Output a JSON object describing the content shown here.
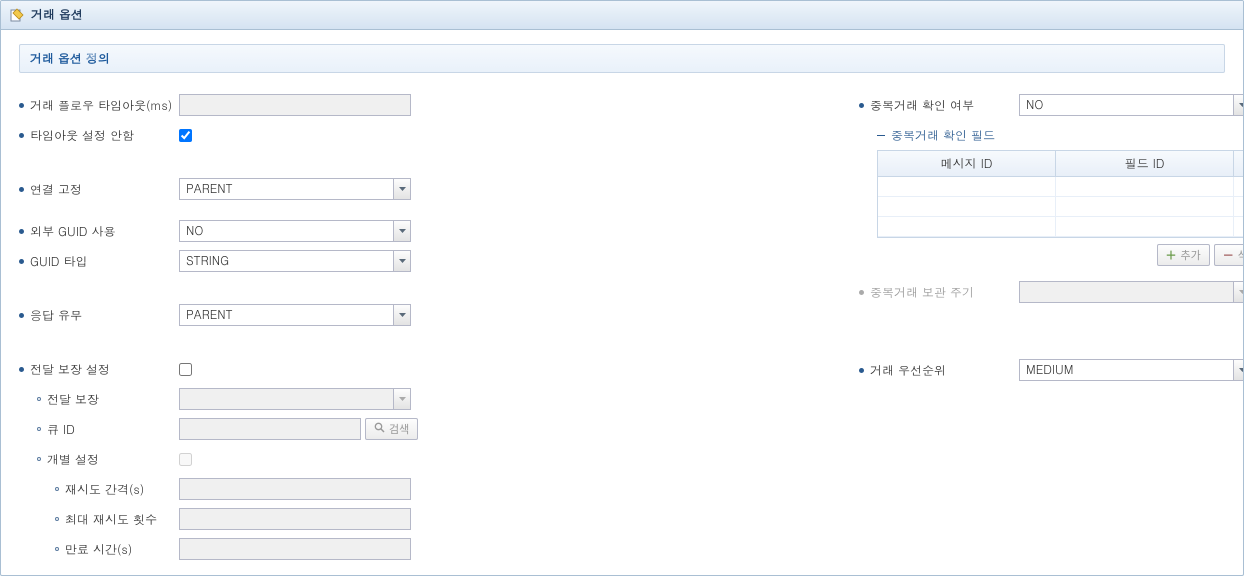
{
  "header": {
    "title": "거래 옵션"
  },
  "sub_header": {
    "title": "거래 옵션 정의"
  },
  "left": {
    "flow_timeout_label": "거래 플로우 타임아웃(ms)",
    "flow_timeout_value": "",
    "no_timeout_label": "타임아웃 설정 안함",
    "no_timeout_checked": true,
    "conn_fix_label": "연결 고정",
    "conn_fix_value": "PARENT",
    "ext_guid_label": "외부 GUID 사용",
    "ext_guid_value": "NO",
    "guid_type_label": "GUID 타입",
    "guid_type_value": "STRING",
    "resp_label": "응답 유무",
    "resp_value": "PARENT",
    "delivery_set_label": "전달 보장 설정",
    "delivery_set_checked": false,
    "delivery_label": "전달 보장",
    "delivery_value": "",
    "queue_id_label": "큐 ID",
    "queue_id_value": "",
    "search_btn": "검색",
    "indiv_set_label": "개별 설정",
    "indiv_set_checked": false,
    "retry_interval_label": "재시도 간격(s)",
    "retry_interval_value": "",
    "max_retry_label": "최대 재시도 횟수",
    "max_retry_value": "",
    "expire_label": "만료 시간(s)",
    "expire_value": ""
  },
  "right": {
    "dup_check_label": "중복거래 확인 여부",
    "dup_check_value": "NO",
    "dup_field_legend": "중복거래 확인 필드",
    "table": {
      "col_msg": "메시지 ID",
      "col_field": "필드 ID"
    },
    "add_btn": "추가",
    "del_btn": "삭제",
    "dup_keep_label": "중복거래 보관 주기",
    "dup_keep_value": "",
    "priority_label": "거래 우선순위",
    "priority_value": "MEDIUM"
  }
}
